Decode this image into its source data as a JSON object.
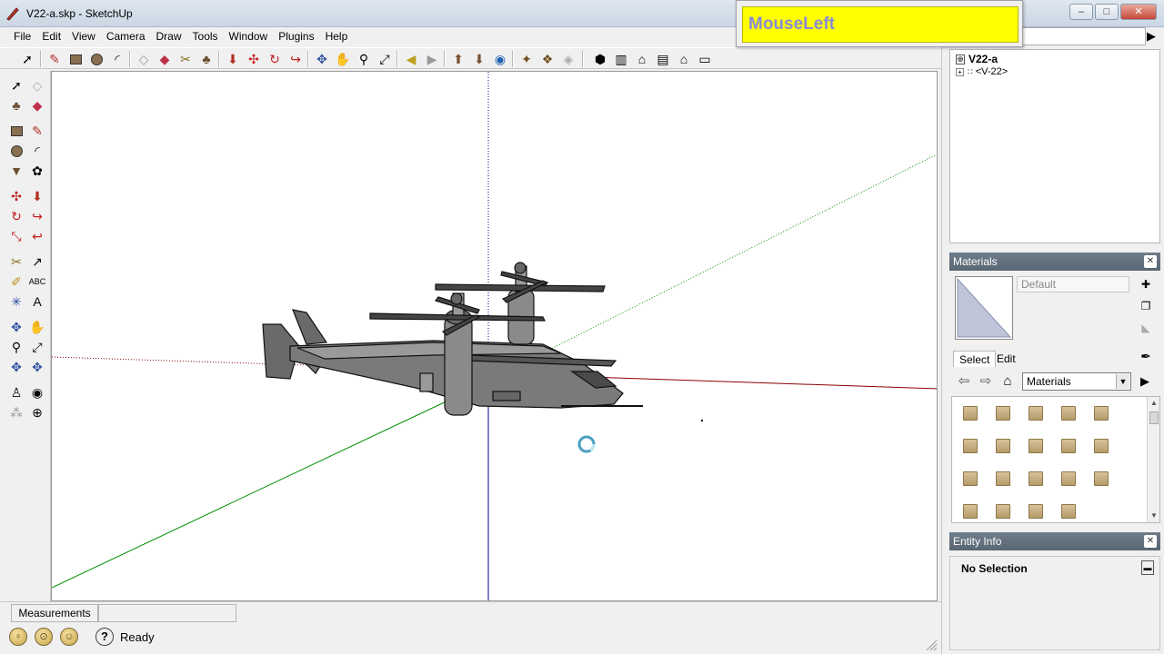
{
  "window": {
    "title": "V22-a.skp - SketchUp"
  },
  "menu": {
    "items": [
      {
        "label": "File",
        "key": "F"
      },
      {
        "label": "Edit",
        "key": "E"
      },
      {
        "label": "View",
        "key": "V"
      },
      {
        "label": "Camera",
        "key": "C"
      },
      {
        "label": "Draw",
        "key": "D"
      },
      {
        "label": "Tools",
        "key": "T"
      },
      {
        "label": "Window",
        "key": "W"
      },
      {
        "label": "Plugins",
        "key": "P"
      },
      {
        "label": "Help",
        "key": "H"
      }
    ]
  },
  "overlay": {
    "text": "MouseLeft"
  },
  "outliner": {
    "root": "V22-a",
    "child": "<V-22>"
  },
  "materials": {
    "title": "Materials",
    "current_name": "Default",
    "tabs": [
      "Select",
      "Edit"
    ],
    "collection": "Materials",
    "swatch_rows": [
      5,
      5,
      5,
      4
    ]
  },
  "entity_info": {
    "title": "Entity Info",
    "selection": "No Selection"
  },
  "status": {
    "measurements_label": "Measurements",
    "text": "Ready"
  },
  "colors": {
    "axis_red": "#8b0000",
    "axis_green": "#009000",
    "axis_blue": "#00008b",
    "overlay_bg": "#ffff00",
    "panel_header": "#5a6673"
  }
}
